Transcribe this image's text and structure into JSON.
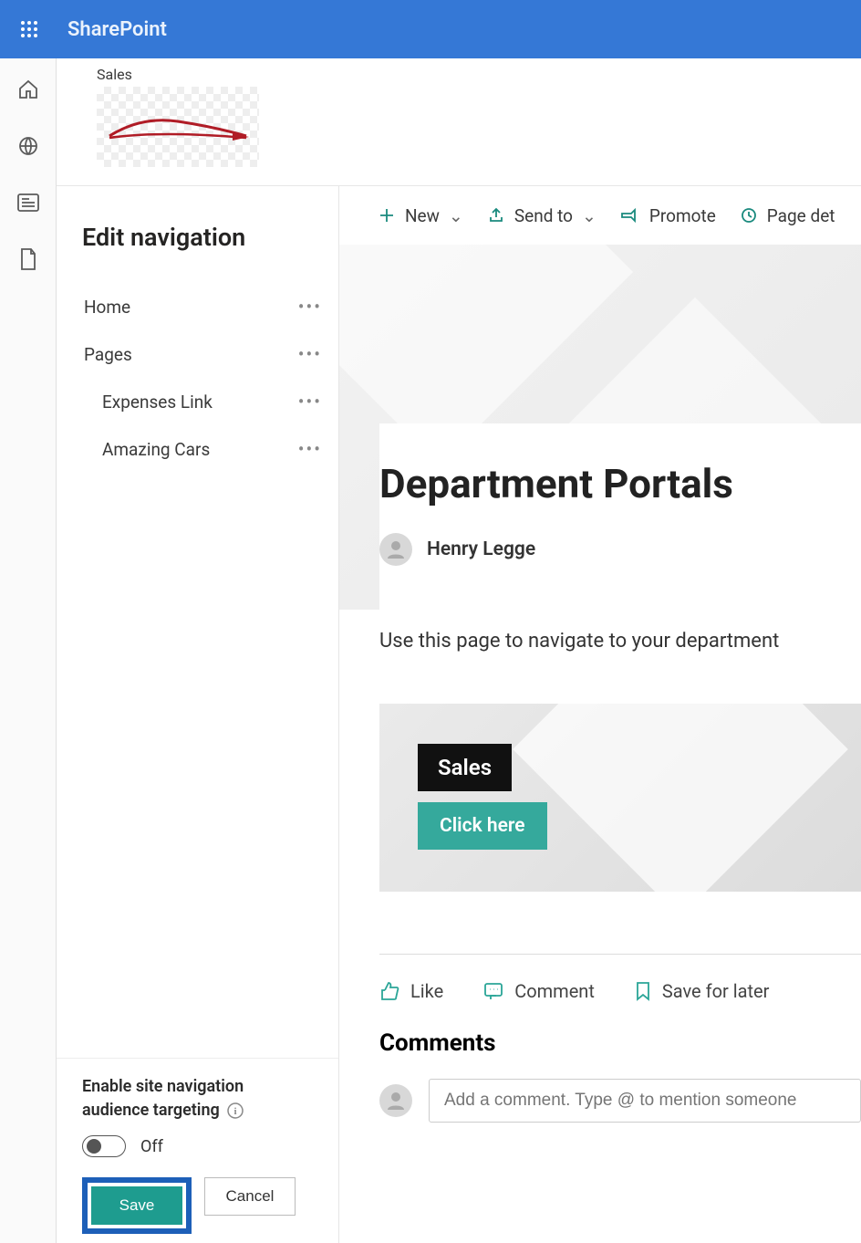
{
  "header": {
    "app_name": "SharePoint"
  },
  "site": {
    "label": "Sales"
  },
  "left_rail": {
    "icons": [
      "home-icon",
      "globe-icon",
      "news-icon",
      "file-icon"
    ]
  },
  "nav_panel": {
    "title": "Edit navigation",
    "items": [
      {
        "label": "Home",
        "indent": 0
      },
      {
        "label": "Pages",
        "indent": 0
      },
      {
        "label": "Expenses Link",
        "indent": 1
      },
      {
        "label": "Amazing Cars",
        "indent": 1
      }
    ],
    "targeting_label_line1": "Enable site navigation",
    "targeting_label_line2": "audience targeting",
    "toggle_state": "Off",
    "save_label": "Save",
    "cancel_label": "Cancel"
  },
  "cmd_bar": {
    "new": "New",
    "send_to": "Send to",
    "promote": "Promote",
    "page_details": "Page det"
  },
  "page": {
    "title": "Department Portals",
    "author": "Henry Legge",
    "description": "Use this page to navigate to your department",
    "hero_tag": "Sales",
    "hero_button": "Click here",
    "like": "Like",
    "comment": "Comment",
    "save_for_later": "Save for later",
    "comments_heading": "Comments",
    "comment_placeholder": "Add a comment. Type @ to mention someone"
  }
}
